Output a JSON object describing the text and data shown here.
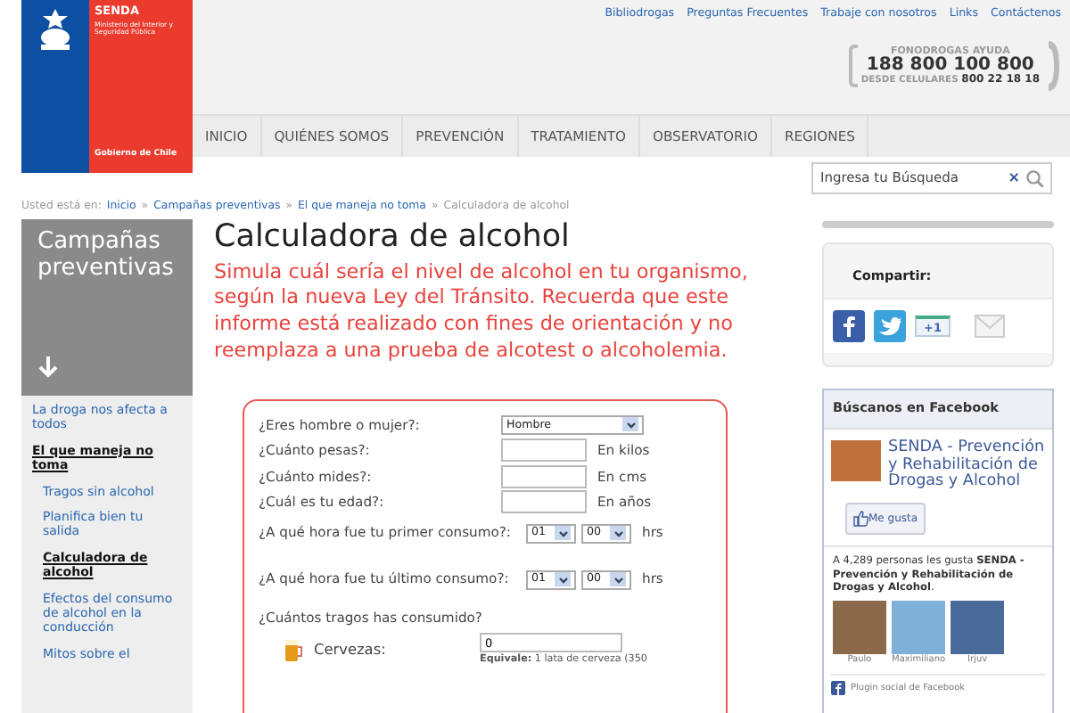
{
  "logo": {
    "name": "SENDA",
    "ministry": "Ministerio del Interior y Seguridad Pública",
    "government": "Gobierno de Chile"
  },
  "top_links": [
    "Bibliodrogas",
    "Preguntas Frecuentes",
    "Trabaje con nosotros",
    "Links",
    "Contáctenos"
  ],
  "hotline": {
    "title": "FONODROGAS AYUDA",
    "number": "188 800 100 800",
    "mobile_label": "DESDE CELULARES",
    "mobile_number": "800 22 18 18"
  },
  "nav": [
    "INICIO",
    "QUIÉNES SOMOS",
    "PREVENCIÓN",
    "TRATAMIENTO",
    "OBSERVATORIO",
    "REGIONES"
  ],
  "search": {
    "placeholder": "Ingresa tu Búsqueda",
    "clear": "×"
  },
  "breadcrumb": {
    "label": "Usted está en:",
    "separator": "»",
    "items": [
      {
        "text": "Inicio",
        "link": true
      },
      {
        "text": "Campañas preventivas",
        "link": true
      },
      {
        "text": "El que maneja no toma",
        "link": true
      },
      {
        "text": "Calculadora de alcohol",
        "link": false
      }
    ]
  },
  "sidebar": {
    "title": "Campañas preventivas",
    "items": [
      {
        "label": "La droga nos afecta a todos",
        "selected": false
      },
      {
        "label": "El que maneja no toma",
        "selected": true,
        "children": [
          {
            "label": "Tragos sin alcohol",
            "selected": false
          },
          {
            "label": "Planifica bien tu salida",
            "selected": false
          },
          {
            "label": "Calculadora de alcohol",
            "selected": true
          },
          {
            "label": "Efectos del consumo de alcohol en la conducción",
            "selected": false
          },
          {
            "label": "Mitos sobre el",
            "selected": false
          }
        ]
      }
    ]
  },
  "title": "Calculadora de alcohol",
  "intro": "Simula cuál sería el nivel de alcohol en tu organismo, según la nueva Ley del Tránsito. Recuerda que este informe está realizado con fines de orientación y no reemplaza a una prueba de alcotest o alcoholemia.",
  "form": {
    "rows": [
      {
        "kind": "select",
        "label": "¿Eres hombre o mujer?:",
        "value": "Hombre"
      },
      {
        "kind": "text",
        "label": "¿Cuánto pesas?:",
        "unit": "En kilos"
      },
      {
        "kind": "text",
        "label": "¿Cuánto mides?:",
        "unit": "En cms"
      },
      {
        "kind": "text",
        "label": "¿Cuál es tu edad?:",
        "unit": "En años"
      },
      {
        "kind": "time",
        "label": "¿A qué hora fue tu primer consumo?:",
        "hour": "01",
        "minute": "00",
        "unit": "hrs"
      },
      {
        "kind": "time",
        "label": "¿A qué hora fue tu último consumo?:",
        "hour": "01",
        "minute": "00",
        "unit": "hrs"
      }
    ],
    "drinks_question": "¿Cuántos tragos has consumido?",
    "drinks": [
      {
        "label": "Cervezas:",
        "value": "0",
        "note": "**Equivale:** 1 lata de cerveza (350"
      }
    ]
  },
  "share": {
    "title": "Compartir:",
    "plus_one": "+1"
  },
  "facebook": {
    "title": "Búscanos en Facebook",
    "page_name": "SENDA - Prevención y Rehabilitación de Drogas y Alcohol",
    "like_button": "Me gusta",
    "likes_text": "A 4,289 personas les gusta **SENDA - Prevención y Rehabilitación de Drogas y Alcohol**.",
    "fans": [
      "Paulo",
      "Maximiliano",
      "Irjuv"
    ],
    "plugin_label": "Plugin social de Facebook"
  }
}
